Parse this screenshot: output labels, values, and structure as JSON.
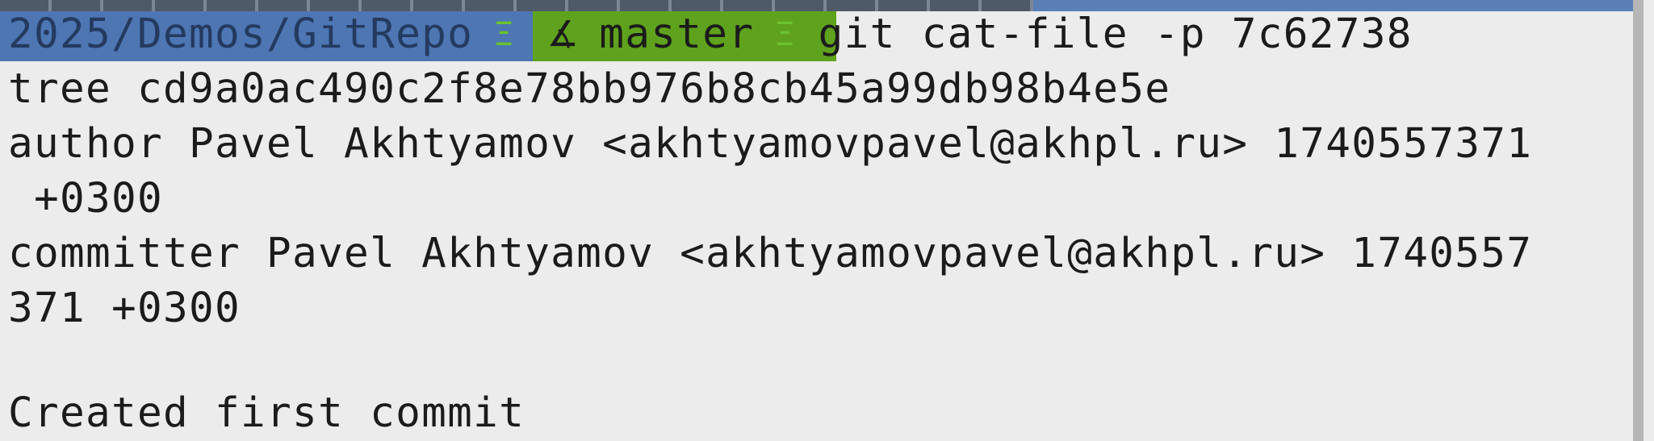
{
  "prompt": {
    "path": "2025/Demos/GitRepo",
    "separator": "Ξ",
    "branch_icon": "∡",
    "branch": "master",
    "command": "git cat-file -p 7c62738"
  },
  "output": {
    "tree_line": "tree cd9a0ac490c2f8e78bb976b8cb45a99db98b4e5e",
    "author_line": "author Pavel Akhtyamov <akhtyamovpavel@akhpl.ru> 1740557371",
    "author_tz": " +0300",
    "committer_line": "committer Pavel Akhtyamov <akhtyamovpavel@akhpl.ru> 1740557",
    "committer_cont": "371 +0300",
    "message": "Created first commit"
  },
  "colors": {
    "background": "#ececec",
    "path_bg": "#4d76b3",
    "branch_bg": "#5fa21d",
    "separator": "#6ac230",
    "text": "#1b1b1b"
  }
}
